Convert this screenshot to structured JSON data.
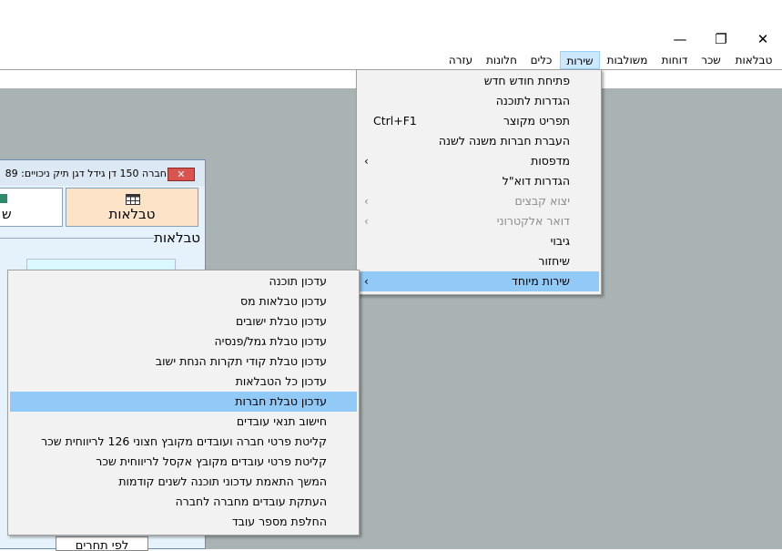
{
  "window": {
    "minimize_icon": "—",
    "restore_icon": "❐",
    "close_icon": "✕"
  },
  "menubar": {
    "items": [
      {
        "label": "טבלאות"
      },
      {
        "label": "שכר"
      },
      {
        "label": "דוחות"
      },
      {
        "label": "משולבות"
      },
      {
        "label": "שירות",
        "active": true
      },
      {
        "label": "כלים"
      },
      {
        "label": "חלונות"
      },
      {
        "label": "עזרה"
      }
    ]
  },
  "child_window": {
    "title": "חברה 150 דן גידל דגן  תיק ניכויים: 89",
    "close_icon": "✕",
    "tabs": [
      {
        "label": "טבלאות",
        "icon": "table-icon"
      },
      {
        "label": "ש",
        "icon": "sheet-icon"
      }
    ],
    "group_label": "טבלאות",
    "bottom_button": "לפי תחרים"
  },
  "service_menu": {
    "items": [
      {
        "label": "פתיחת חודש חדש"
      },
      {
        "label": "הגדרות לתוכנה"
      },
      {
        "label": "תפריט מקוצר",
        "shortcut": "Ctrl+F1"
      },
      {
        "label": "העברת חברות משנה לשנה"
      },
      {
        "label": "מדפסות",
        "submenu": true
      },
      {
        "label": "הגדרות דוא\"ל"
      },
      {
        "label": "יצוא קבצים",
        "submenu": true,
        "disabled": true
      },
      {
        "label": "דואר אלקטרוני",
        "submenu": true,
        "disabled": true
      },
      {
        "label": "גיבוי"
      },
      {
        "label": "שיחזור"
      },
      {
        "label": "שירות מיוחד",
        "submenu": true,
        "highlighted": true
      }
    ],
    "arrow": "›"
  },
  "special_submenu": {
    "items": [
      {
        "label": "עדכון תוכנה"
      },
      {
        "label": "עדכון טבלאות מס"
      },
      {
        "label": "עדכון טבלת ישובים"
      },
      {
        "label": "עדכון טבלת גמל/פנסיה"
      },
      {
        "label": "עדכון טבלת קודי תקרות הנחת ישוב"
      },
      {
        "label": "עדכון כל הטבלאות"
      },
      {
        "label": "עדכון טבלת חברות",
        "highlighted": true
      },
      {
        "label": "חישוב תנאי עובדים"
      },
      {
        "label": "קליטת פרטי חברה ועובדים מקובץ חצוני 126 לריווחית שכר"
      },
      {
        "label": "קליטת פרטי עובדים מקובץ אקסל לריווחית שכר"
      },
      {
        "label": "המשך התאמת עדכוני תוכנה לשנים קודמות"
      },
      {
        "label": "העתקת עובדים מחברה לחברה"
      },
      {
        "label": "החלפת מספר עובד"
      }
    ]
  },
  "colors": {
    "workspace": "#a9b3b3",
    "highlight": "#91c9f7",
    "menu_bg": "#f2f2f2"
  }
}
